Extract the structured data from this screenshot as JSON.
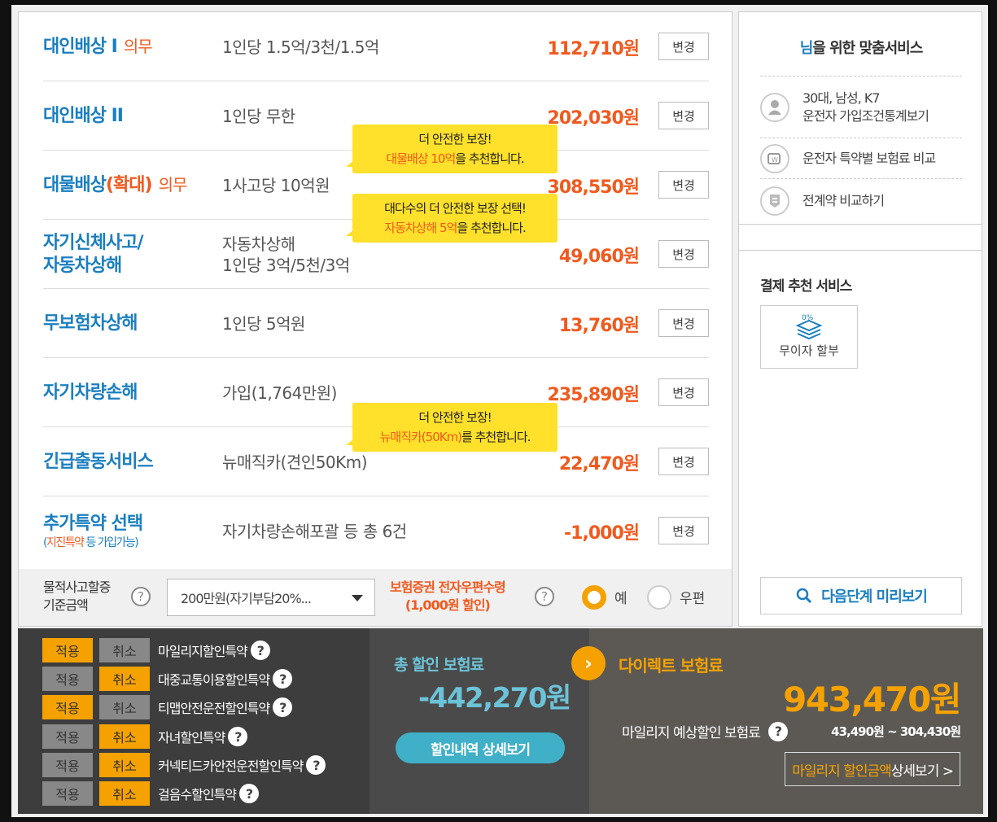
{
  "coverage": [
    {
      "name": "대인배상 I",
      "req": "의무",
      "desc": [
        "1인당 1.5억/3천/1.5억"
      ],
      "price": "112,710원",
      "btn": "변경"
    },
    {
      "name": "대인배상 II",
      "req": "",
      "desc": [
        "1인당 무한"
      ],
      "price": "202,030원",
      "btn": "변경"
    },
    {
      "name": "대물배상",
      "name_hl": "(확대)",
      "req": "의무",
      "desc": [
        "1사고당 10억원"
      ],
      "price": "308,550원",
      "btn": "변경"
    },
    {
      "name": "자기신체사고/",
      "name2": "자동차상해",
      "req": "",
      "desc": [
        "자동차상해",
        "1인당 3억/5천/3억"
      ],
      "price": "49,060원",
      "btn": "변경"
    },
    {
      "name": "무보험차상해",
      "req": "",
      "desc": [
        "1인당 5억원"
      ],
      "price": "13,760원",
      "btn": "변경"
    },
    {
      "name": "자기차량손해",
      "req": "",
      "desc": [
        "가입(1,764만원)"
      ],
      "price": "235,890원",
      "btn": "변경"
    },
    {
      "name": "긴급출동서비스",
      "req": "",
      "desc": [
        "뉴매직카(견인50Km)"
      ],
      "price": "22,470원",
      "btn": "변경"
    },
    {
      "name": "추가특약 선택",
      "sub_pre": "(",
      "sub_hl": "지진특약",
      "sub_post": " 등 가입가능)",
      "req": "",
      "desc": [
        "자기차량손해포괄 등 총 6건"
      ],
      "price": "-1,000원",
      "btn": "변경"
    }
  ],
  "tips": [
    {
      "line1": "더 안전한 보장!",
      "hl": "대물배상 10억",
      "rest": "을 추천합니다."
    },
    {
      "line1": "대다수의 더 안전한 보장 선택!",
      "hl": "자동차상해 5억",
      "rest": "을 추천합니다."
    },
    {
      "line1": "더 안전한 보장!",
      "hl": "뉴매직카(50Km)",
      "rest": "를 추천합니다."
    }
  ],
  "property": {
    "label1": "물적사고할증",
    "label2": "기준금액",
    "select_value": "200만원(자기부담20%..."
  },
  "ecert": {
    "label": "보험증권 전자우편수령",
    "sub": "(1,000원 할인)",
    "opt_yes": "예",
    "opt_no": "우편"
  },
  "sidebar": {
    "title_hl": "님",
    "title": "을 위한 맞춤서비스",
    "items": [
      {
        "l1": "30대, 남성, K7",
        "l2": "운전자 가입조건통계보기"
      },
      {
        "l1": "운전자 특약별 보험료 비교",
        "l2": ""
      },
      {
        "l1": "전계약 비교하기",
        "l2": ""
      }
    ],
    "pay_title": "결제 추천 서비스",
    "pay_badge": "0%",
    "pay_label": "무이자 할부",
    "next": "다음단계 미리보기"
  },
  "discounts": {
    "apply": "적용",
    "cancel": "취소",
    "items": [
      {
        "name": "마일리지할인특약",
        "applied": true
      },
      {
        "name": "대중교통이용할인특약",
        "applied": false
      },
      {
        "name": "티맵안전운전할인특약",
        "applied": true
      },
      {
        "name": "자녀할인특약",
        "applied": false
      },
      {
        "name": "커넥티드카안전운전할인특약",
        "applied": false
      },
      {
        "name": "걸음수할인특약",
        "applied": false
      }
    ]
  },
  "total": {
    "label": "총 할인 보험료",
    "value": "-442,270원",
    "btn": "할인내역 상세보기"
  },
  "direct": {
    "label": "다이렉트 보험료",
    "value": "943,470원",
    "mile_label": "마일리지 예상할인 보험료",
    "mile_range": "43,490원 ~ 304,430원",
    "mile_btn_hl": "마일리지 할인금액",
    "mile_btn": " 상세보기 >"
  }
}
